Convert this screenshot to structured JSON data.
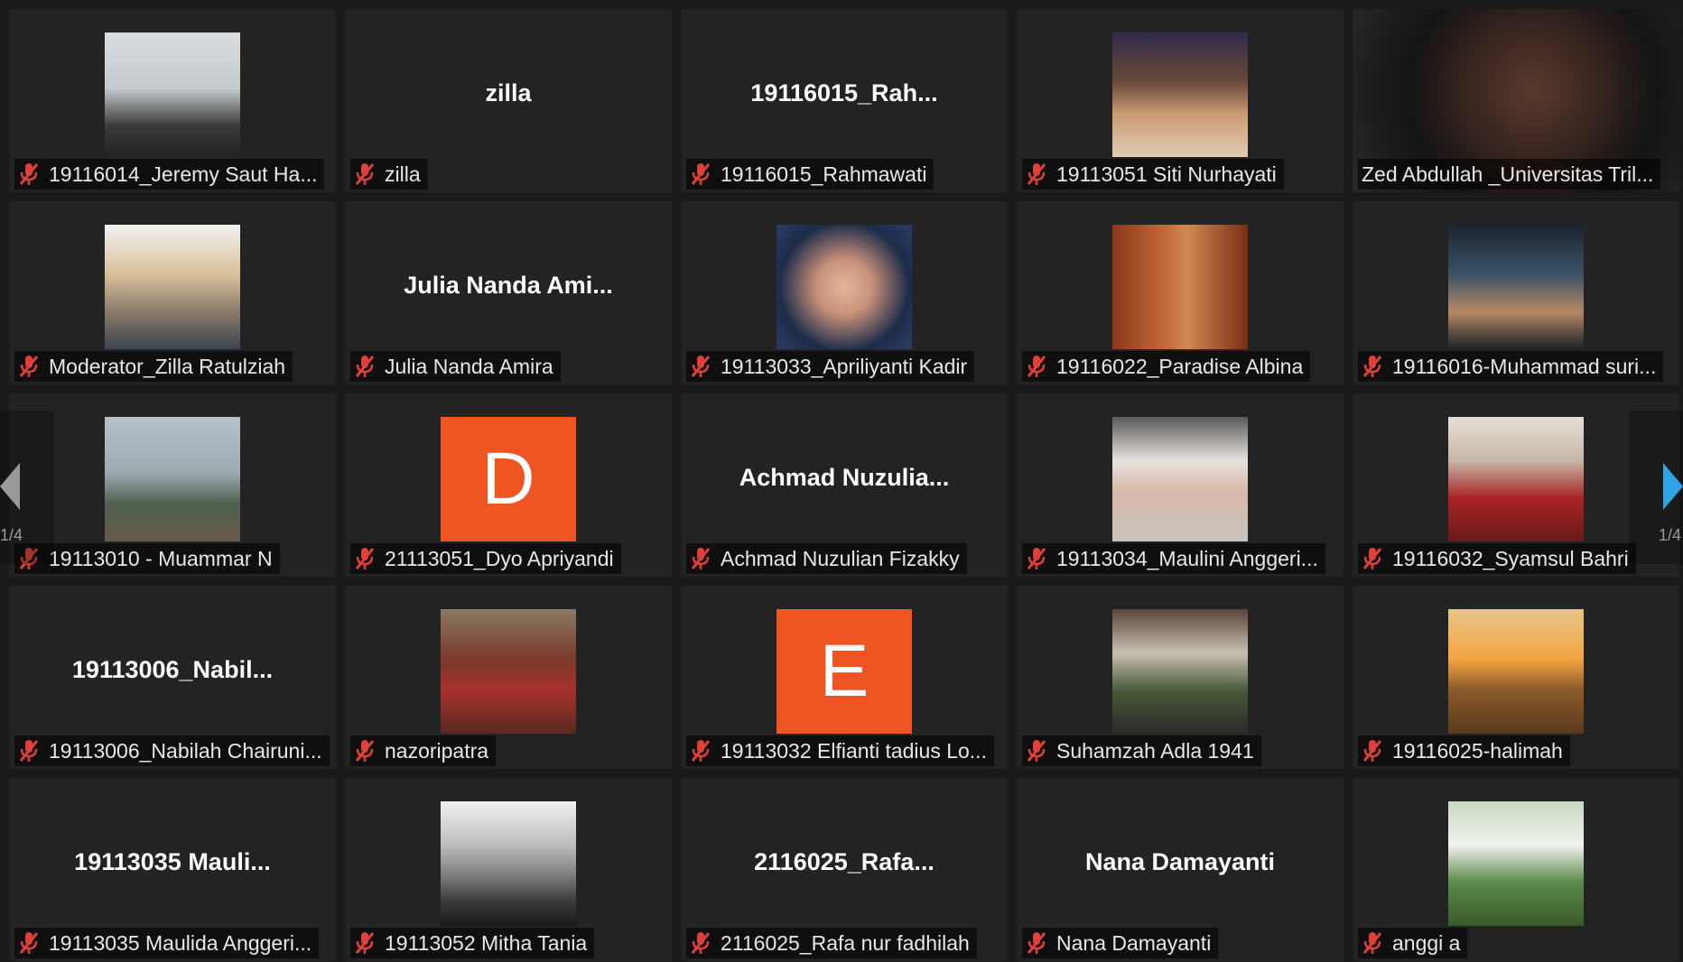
{
  "colors": {
    "active_border": "#c8e05a",
    "muted_icon": "#e0403a",
    "avatar_letter_bg": "#ef5523",
    "nav_arrow": "#2fa3e6"
  },
  "navigation": {
    "left_page": "1/4",
    "right_page": "1/4"
  },
  "participants": [
    {
      "label": "19116014_Jeremy Saut Ha...",
      "photo": "person-writing"
    },
    {
      "label": "zilla",
      "display_name": "zilla"
    },
    {
      "label": "19116015_Rahmawati",
      "display_name": "19116015_Rah..."
    },
    {
      "label": "19113051 Siti Nurhayati",
      "photo": "woman-restaurant"
    },
    {
      "label": "Zed Abdullah _Universitas Tril...",
      "photo": "man-starry-background",
      "active_speaker": true
    },
    {
      "label": "Moderator_Zilla Ratulziah",
      "photo": "woman-hijab"
    },
    {
      "label": "Julia Nanda Amira",
      "display_name": "Julia Nanda Ami..."
    },
    {
      "label": "19113033_Apriliyanti Kadir",
      "photo": "woman-selfie"
    },
    {
      "label": "19116022_Paradise Albina",
      "photo": "woman-brick-wall"
    },
    {
      "label": "19116016-Muhammad suri...",
      "photo": "man-city-night"
    },
    {
      "label": "19113010 - Muammar N",
      "photo": "person-outdoor-lamp"
    },
    {
      "label": "21113051_Dyo Apriyandi",
      "avatar_letter": "D"
    },
    {
      "label": "Achmad Nuzulian Fizakky",
      "display_name": "Achmad  Nuzulia..."
    },
    {
      "label": "19113034_Maulini Anggeri...",
      "photo": "woman-white-hijab"
    },
    {
      "label": "19116032_Syamsul Bahri",
      "photo": "family-photo"
    },
    {
      "label": "19113006_Nabilah Chairuni...",
      "display_name": "19113006_Nabil..."
    },
    {
      "label": "nazoripatra",
      "photo": "red-crowd-scene"
    },
    {
      "label": "19113032 Elfianti tadius Lo...",
      "avatar_letter": "E"
    },
    {
      "label": "Suhamzah Adla 1941",
      "photo": "man-traditional-house"
    },
    {
      "label": "19116025-halimah",
      "photo": "sunset-landscape"
    },
    {
      "label": "19113035 Maulida Anggeri...",
      "display_name": "19113035  Mauli..."
    },
    {
      "label": "19113052 Mitha Tania",
      "photo": "misty-mountains"
    },
    {
      "label": "2116025_Rafa nur fadhilah",
      "display_name": "2116025_Rafa..."
    },
    {
      "label": "Nana Damayanti",
      "display_name": "Nana Damayanti"
    },
    {
      "label": "anggi a",
      "photo": "person-garden"
    }
  ]
}
